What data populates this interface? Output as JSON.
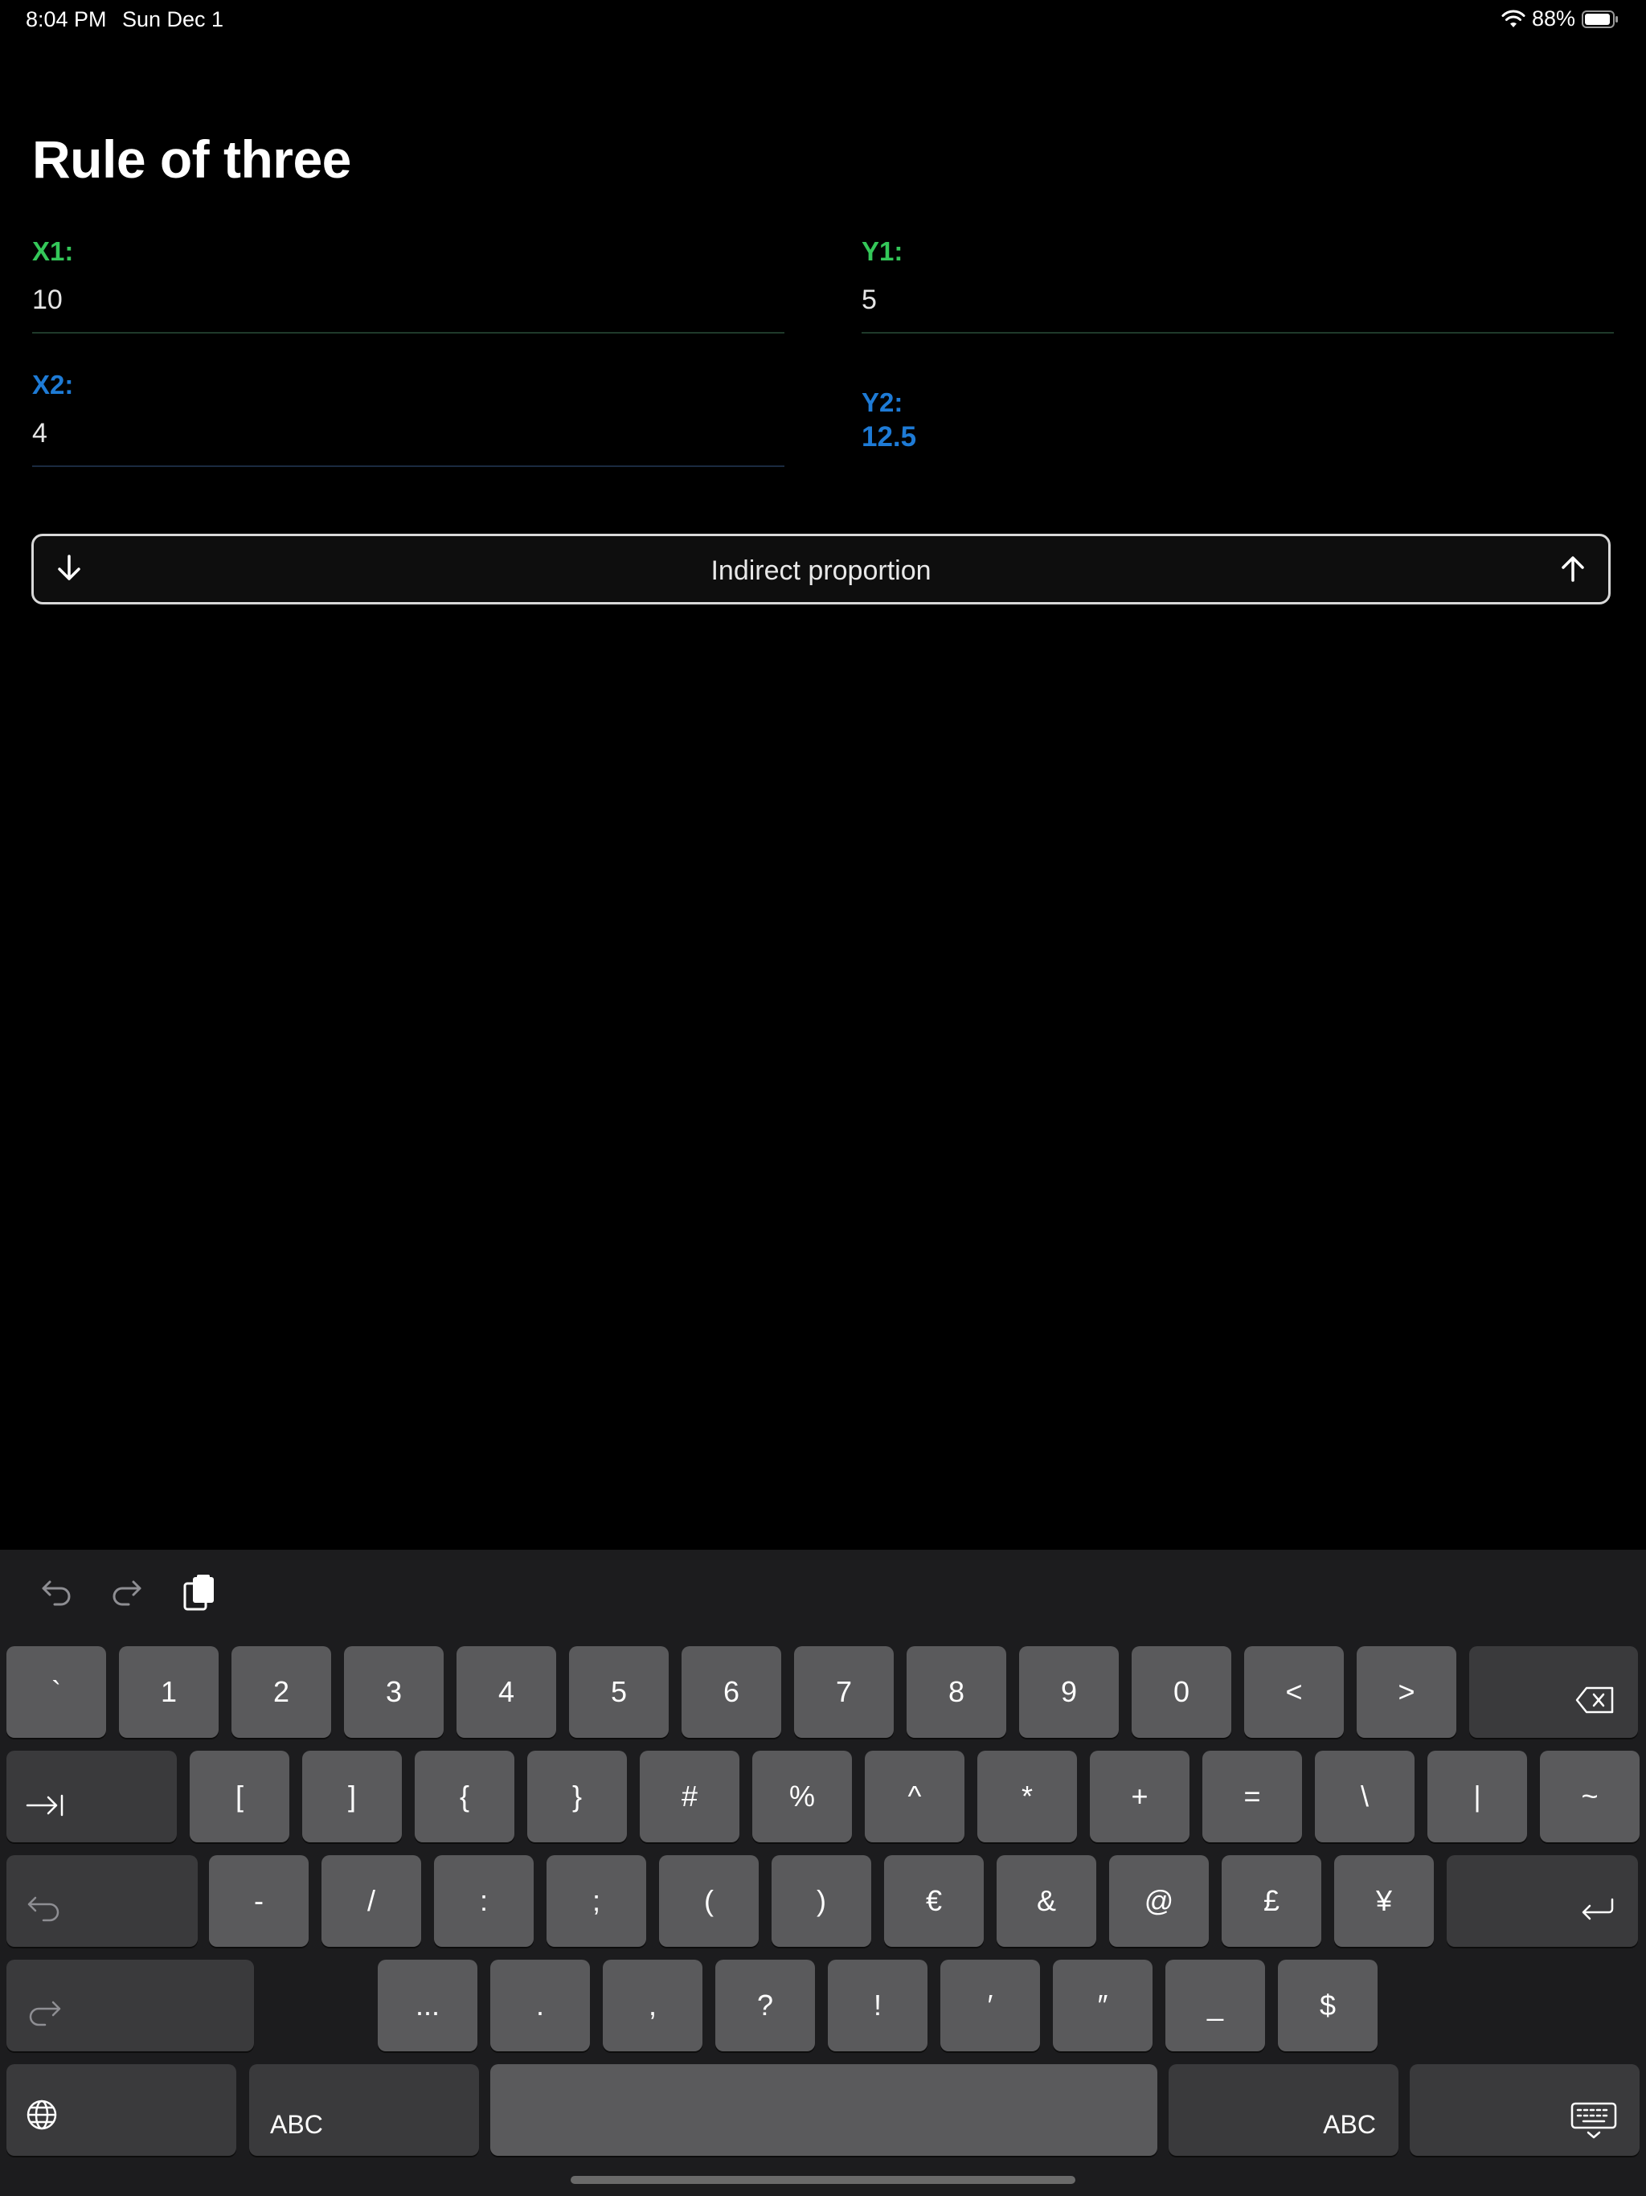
{
  "status_bar": {
    "time": "8:04 PM",
    "date": "Sun Dec 1",
    "battery": "88%"
  },
  "title": "Rule of three",
  "fields": {
    "x1": {
      "label": "X1:",
      "value": "10"
    },
    "y1": {
      "label": "Y1:",
      "value": "5"
    },
    "x2": {
      "label": "X2:",
      "value": "4"
    },
    "y2": {
      "label": "Y2:",
      "value": "12.5"
    }
  },
  "proportion_button": {
    "label": "Indirect proportion"
  },
  "keyboard": {
    "row1": [
      "`",
      "1",
      "2",
      "3",
      "4",
      "5",
      "6",
      "7",
      "8",
      "9",
      "0",
      "<",
      ">"
    ],
    "row2": [
      "[",
      "]",
      "{",
      "}",
      "#",
      "%",
      "^",
      "*",
      "+",
      "=",
      "\\",
      "|",
      "~"
    ],
    "row3": [
      "-",
      "/",
      ":",
      ";",
      "(",
      ")",
      "€",
      "&",
      "@",
      "£",
      "¥"
    ],
    "row4": [
      "...",
      ".",
      ",",
      "?",
      "!",
      "′",
      "″",
      "_",
      "$"
    ],
    "abc_left": "ABC",
    "abc_right": "ABC"
  },
  "colors": {
    "green": "#34c759",
    "blue": "#1e7bd6",
    "key": "#5a5a5c",
    "key_dark": "#3a3a3c"
  }
}
